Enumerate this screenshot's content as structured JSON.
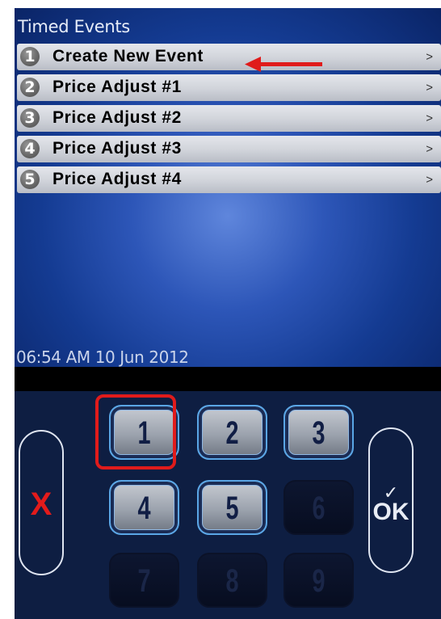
{
  "screen": {
    "title": "Timed Events",
    "datetime": "06:54 AM 10 Jun 2012"
  },
  "menu": {
    "items": [
      {
        "number": "1",
        "label": "Create New Event",
        "arrow": ">"
      },
      {
        "number": "2",
        "label": "Price Adjust #1",
        "arrow": ">"
      },
      {
        "number": "3",
        "label": "Price Adjust #2",
        "arrow": ">"
      },
      {
        "number": "4",
        "label": "Price Adjust #3",
        "arrow": ">"
      },
      {
        "number": "5",
        "label": "Price Adjust #4",
        "arrow": ">"
      }
    ]
  },
  "keypad": {
    "keys": [
      {
        "label": "1",
        "enabled": true
      },
      {
        "label": "2",
        "enabled": true
      },
      {
        "label": "3",
        "enabled": true
      },
      {
        "label": "4",
        "enabled": true
      },
      {
        "label": "5",
        "enabled": true
      },
      {
        "label": "6",
        "enabled": false
      },
      {
        "label": "7",
        "enabled": false
      },
      {
        "label": "8",
        "enabled": false
      },
      {
        "label": "9",
        "enabled": false
      }
    ],
    "cancel_label": "X",
    "ok_check": "✓",
    "ok_label": "OK"
  },
  "colors": {
    "annotation": "#e01b1b",
    "screen_background": "#2d56b8",
    "menu_row": "#d0d3da",
    "keypad_background": "#0e1e42",
    "key_border": "#5aa6e6"
  },
  "icons": {
    "menu_row_arrow": "chevron-right-icon",
    "annotation": "left-arrow-icon",
    "cancel": "x-icon",
    "ok": "check-icon"
  }
}
